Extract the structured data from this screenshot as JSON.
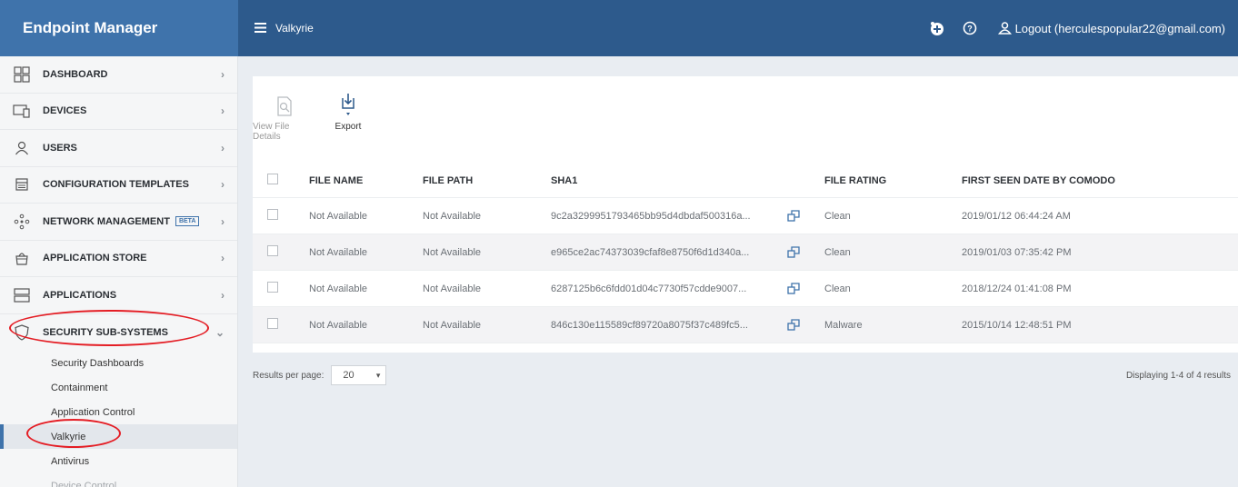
{
  "header": {
    "brand": "Endpoint Manager",
    "breadcrumb": "Valkyrie",
    "logout_label": "Logout (herculespopular22@gmail.com)"
  },
  "sidebar": {
    "items": [
      {
        "label": "DASHBOARD",
        "icon": "dashboard-icon"
      },
      {
        "label": "DEVICES",
        "icon": "devices-icon"
      },
      {
        "label": "USERS",
        "icon": "users-icon"
      },
      {
        "label": "CONFIGURATION TEMPLATES",
        "icon": "templates-icon"
      },
      {
        "label": "NETWORK MANAGEMENT",
        "icon": "network-icon",
        "badge": "BETA"
      },
      {
        "label": "APPLICATION STORE",
        "icon": "store-icon"
      },
      {
        "label": "APPLICATIONS",
        "icon": "applications-icon"
      },
      {
        "label": "SECURITY SUB-SYSTEMS",
        "icon": "shield-icon",
        "expanded": true
      }
    ],
    "sub_items": [
      {
        "label": "Security Dashboards"
      },
      {
        "label": "Containment"
      },
      {
        "label": "Application Control"
      },
      {
        "label": "Valkyrie",
        "active": true
      },
      {
        "label": "Antivirus"
      },
      {
        "label": "Device Control"
      }
    ]
  },
  "toolbar": {
    "view_file_details": "View File Details",
    "export": "Export"
  },
  "table": {
    "columns": [
      "FILE NAME",
      "FILE PATH",
      "SHA1",
      "FILE RATING",
      "FIRST SEEN DATE BY COMODO"
    ],
    "rows": [
      {
        "name": "Not Available",
        "path": "Not Available",
        "sha1": "9c2a3299951793465bb95d4dbdaf500316a...",
        "rating": "Clean",
        "date": "2019/01/12 06:44:24 AM"
      },
      {
        "name": "Not Available",
        "path": "Not Available",
        "sha1": "e965ce2ac74373039cfaf8e8750f6d1d340a...",
        "rating": "Clean",
        "date": "2019/01/03 07:35:42 PM"
      },
      {
        "name": "Not Available",
        "path": "Not Available",
        "sha1": "6287125b6c6fdd01d04c7730f57cdde9007...",
        "rating": "Clean",
        "date": "2018/12/24 01:41:08 PM"
      },
      {
        "name": "Not Available",
        "path": "Not Available",
        "sha1": "846c130e115589cf89720a8075f37c489fc5...",
        "rating": "Malware",
        "date": "2015/10/14 12:48:51 PM"
      }
    ]
  },
  "pager": {
    "results_per_page_label": "Results per page:",
    "results_per_page_value": "20",
    "displaying": "Displaying 1-4 of 4 results"
  },
  "colors": {
    "header": "#2d5a8c",
    "brand": "#3f73ab",
    "annotation": "#e41e25"
  }
}
